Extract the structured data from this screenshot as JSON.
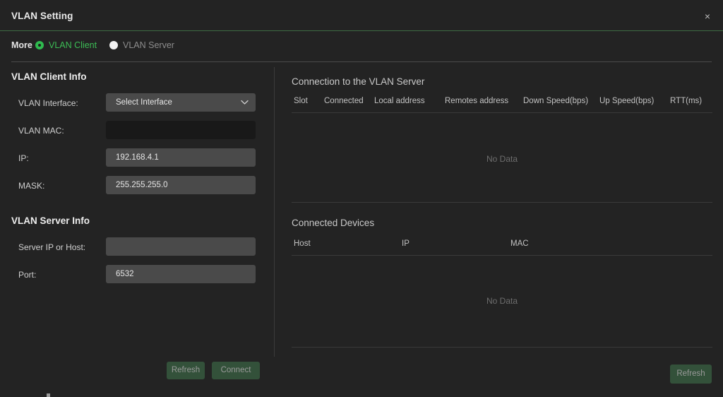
{
  "window": {
    "title": "VLAN Setting",
    "close_label": "×"
  },
  "mode_row": {
    "label": "More",
    "options": [
      {
        "label": "VLAN Client",
        "selected": true
      },
      {
        "label": "VLAN Server",
        "selected": false
      }
    ]
  },
  "client_info": {
    "section_title": "VLAN Client Info",
    "fields": [
      {
        "label": "VLAN Interface:",
        "value": "Select Interface",
        "type": "select"
      },
      {
        "label": "VLAN MAC:",
        "value": "",
        "type": "text"
      },
      {
        "label": "IP:",
        "value": "192.168.4.1",
        "type": "text"
      },
      {
        "label": "MASK:",
        "value": "255.255.255.0",
        "type": "text"
      }
    ]
  },
  "server_info": {
    "section_title": "VLAN Server Info",
    "fields": [
      {
        "label": "Server IP or Host:",
        "value": "",
        "type": "text"
      },
      {
        "label": "Port:",
        "value": "6532",
        "type": "text"
      }
    ]
  },
  "left_actions": {
    "refresh_label": "Refresh",
    "connect_label": "Connect"
  },
  "connection_panel": {
    "title": "Connection to the VLAN Server",
    "columns": [
      "Slot",
      "Connected",
      "Local address",
      "Remotes address",
      "Down Speed(bps)",
      "Up Speed(bps)",
      "RTT(ms)"
    ],
    "rows": [],
    "empty_text": "No Data"
  },
  "devices_panel": {
    "title": "Connected Devices",
    "columns": [
      "Host",
      "IP",
      "MAC"
    ],
    "rows": [],
    "empty_text": "No Data"
  },
  "right_actions": {
    "refresh_label": "Refresh"
  },
  "colors": {
    "accent_green": "#3cbd55",
    "button_green": "#33513a",
    "background": "#232323",
    "field": "#4a4a4a"
  }
}
